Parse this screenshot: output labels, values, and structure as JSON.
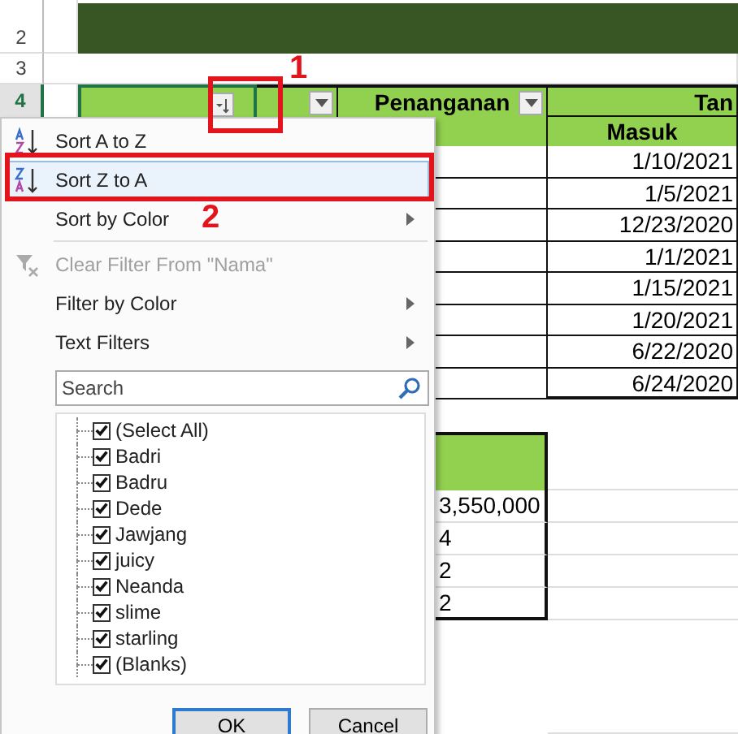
{
  "sheet": {
    "row_labels": [
      {
        "label": "2",
        "selected": false
      },
      {
        "label": "3",
        "selected": false
      },
      {
        "label": "4",
        "selected": true
      }
    ],
    "header": {
      "column_4": "Penanganan",
      "column_5_top": "Tan",
      "column_5_bottom": "Masuk"
    },
    "filter_buttons": [
      {
        "kind": "sorted"
      },
      {
        "kind": "dropdown"
      },
      {
        "kind": "dropdown"
      }
    ],
    "dates": [
      "1/10/2021",
      "1/5/2021",
      "12/23/2020",
      "1/1/2021",
      "1/15/2021",
      "1/20/2021",
      "6/22/2020",
      "6/24/2020"
    ],
    "summary_values": [
      "3,550,000",
      "4",
      "2",
      "2"
    ]
  },
  "menu": {
    "sort_items": [
      {
        "label": "Sort A to Z",
        "selected": false,
        "submenu": false
      },
      {
        "label": "Sort Z to A",
        "selected": true,
        "submenu": false
      },
      {
        "label": "Sort by Color",
        "selected": false,
        "submenu": true
      }
    ],
    "filter_items": [
      {
        "label": "Clear Filter From \"Nama\"",
        "disabled": true,
        "submenu": false
      },
      {
        "label": "Filter by Color",
        "disabled": false,
        "submenu": true
      },
      {
        "label": "Text Filters",
        "disabled": false,
        "submenu": true
      }
    ],
    "search": {
      "placeholder": "Search"
    },
    "checklist": [
      {
        "label": "(Select All)",
        "checked": true
      },
      {
        "label": "Badri",
        "checked": true
      },
      {
        "label": "Badru",
        "checked": true
      },
      {
        "label": "Dede",
        "checked": true
      },
      {
        "label": "Jawjang",
        "checked": true
      },
      {
        "label": "juicy",
        "checked": true
      },
      {
        "label": "Neanda",
        "checked": true
      },
      {
        "label": "slime",
        "checked": true
      },
      {
        "label": "starling",
        "checked": true
      },
      {
        "label": "(Blanks)",
        "checked": true
      }
    ],
    "buttons": [
      {
        "label": "OK",
        "selected": true
      },
      {
        "label": "Cancel",
        "selected": false
      }
    ]
  },
  "annotations": [
    {
      "label": "1"
    },
    {
      "label": "2"
    }
  ]
}
